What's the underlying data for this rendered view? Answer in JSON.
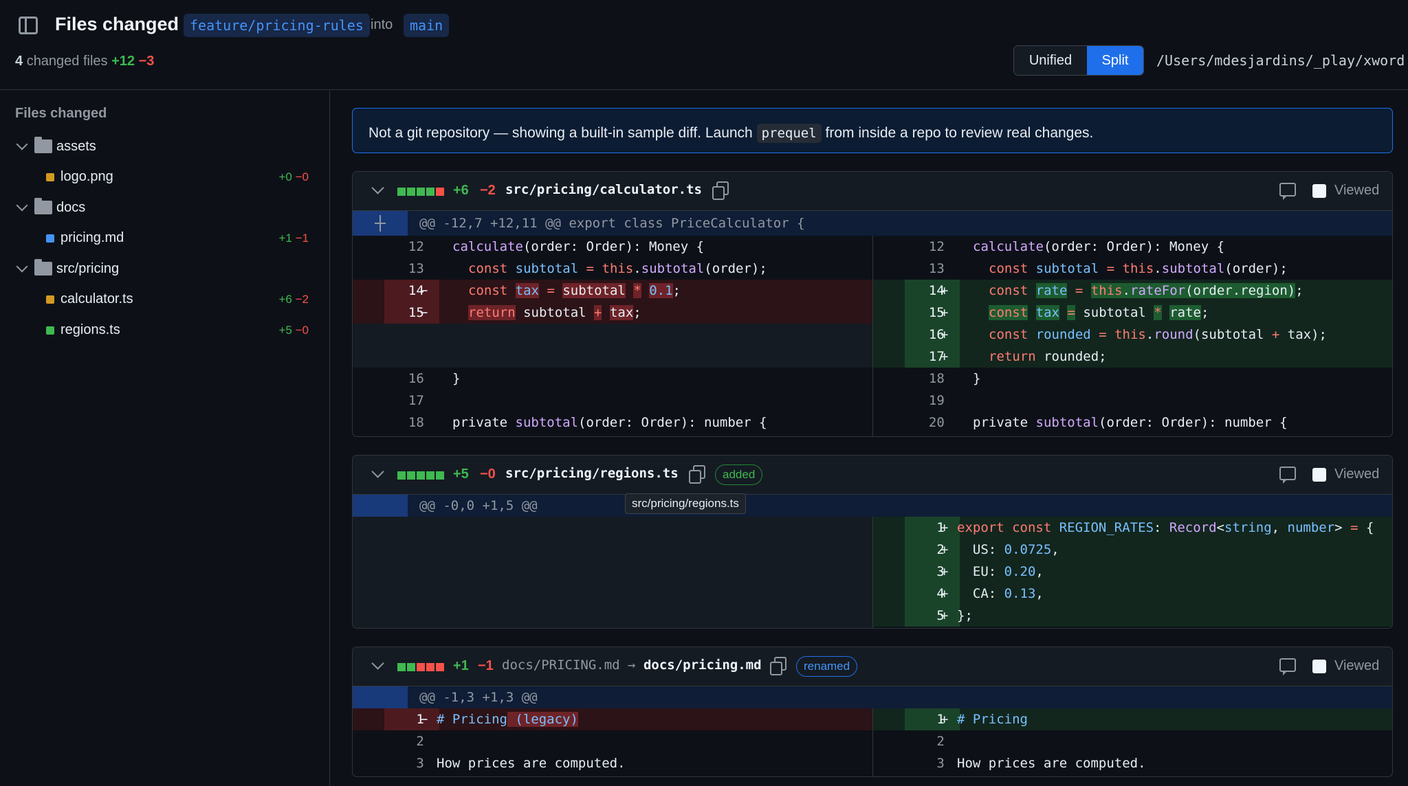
{
  "header": {
    "title": "Files changed",
    "head_branch": "feature/pricing-rules",
    "into_label": "into",
    "base_branch": "main",
    "summary_count": "4",
    "summary_label": "changed files",
    "summary_add": "+12",
    "summary_del": "−3",
    "view_toggle": {
      "unified": "Unified",
      "split": "Split",
      "active": "Split"
    },
    "repo_path": "/Users/mdesjardins/_play/xword"
  },
  "sidebar": {
    "title": "Files changed",
    "tree": [
      {
        "type": "folder",
        "label": "assets"
      },
      {
        "type": "file",
        "label": "logo.png",
        "color": "#d29922",
        "add": "+0",
        "del": "−0"
      },
      {
        "type": "folder",
        "label": "docs"
      },
      {
        "type": "file",
        "label": "pricing.md",
        "color": "#4493f8",
        "add": "+1",
        "del": "−1"
      },
      {
        "type": "folder",
        "label": "src/pricing"
      },
      {
        "type": "file",
        "label": "calculator.ts",
        "color": "#d29922",
        "add": "+6",
        "del": "−2"
      },
      {
        "type": "file",
        "label": "regions.ts",
        "color": "#3fb950",
        "add": "+5",
        "del": "−0"
      }
    ]
  },
  "banner": {
    "before": "Not a git repository — showing a built-in sample diff. Launch",
    "command": "prequel",
    "after": "from inside a repo to review real changes."
  },
  "files": [
    {
      "add": "+6",
      "del": "−2",
      "name": "src/pricing/calculator.ts",
      "hunk": "@@ -12,7 +12,11 @@ export class PriceCalculator {",
      "viewed_label": "Viewed",
      "left_ln": [
        "12",
        "13",
        "14",
        "15",
        "",
        "",
        "16",
        "17",
        "18"
      ],
      "right_ln": [
        "12",
        "13",
        "14",
        "15",
        "16",
        "17",
        "18",
        "19",
        "20"
      ]
    },
    {
      "add": "+5",
      "del": "−0",
      "name": "src/pricing/regions.ts",
      "badge": "added",
      "hunk": "@@ -0,0 +1,5 @@",
      "viewed_label": "Viewed",
      "right_ln": [
        "1",
        "2",
        "3",
        "4",
        "5"
      ],
      "tooltip": "src/pricing/regions.ts"
    },
    {
      "add": "+1",
      "del": "−1",
      "old_name": "docs/PRICING.md",
      "arrow": "→",
      "name": "docs/pricing.md",
      "badge": "renamed",
      "hunk": "@@ -1,3 +1,3 @@",
      "viewed_label": "Viewed",
      "left_ln": [
        "1",
        "2",
        "3"
      ],
      "right_ln": [
        "1",
        "2",
        "3"
      ]
    }
  ],
  "code": {
    "c1_l1": "calculate(order: Order): Money {",
    "c1_l2": "const subtotal = this.subtotal(order);",
    "c1_l3": "const tax = subtotal * 0.1;",
    "c1_l4": "return subtotal + tax;",
    "c1_l5": "}",
    "c1_l6": "",
    "c1_l7": "private subtotal(order: Order): number {",
    "c1_r3": "const rate = this.rateFor(order.region);",
    "c1_r4": "const tax = subtotal * rate;",
    "c1_r5": "const rounded = this.round(subtotal + tax);",
    "c1_r6": "return rounded;",
    "c2_r1": "export const REGION_RATES: Record<string, number> = {",
    "c2_r2": "  US: 0.0725,",
    "c2_r3": "  EU: 0.20,",
    "c2_r4": "  CA: 0.13,",
    "c2_r5": "};",
    "c3_l1": "# Pricing (legacy)",
    "c3_r1": "# Pricing",
    "c3_3": "How prices are computed."
  },
  "colors": {
    "accent": "#1f6feb",
    "added": "#3fb950",
    "deleted": "#f85149",
    "background": "#0d1117"
  }
}
